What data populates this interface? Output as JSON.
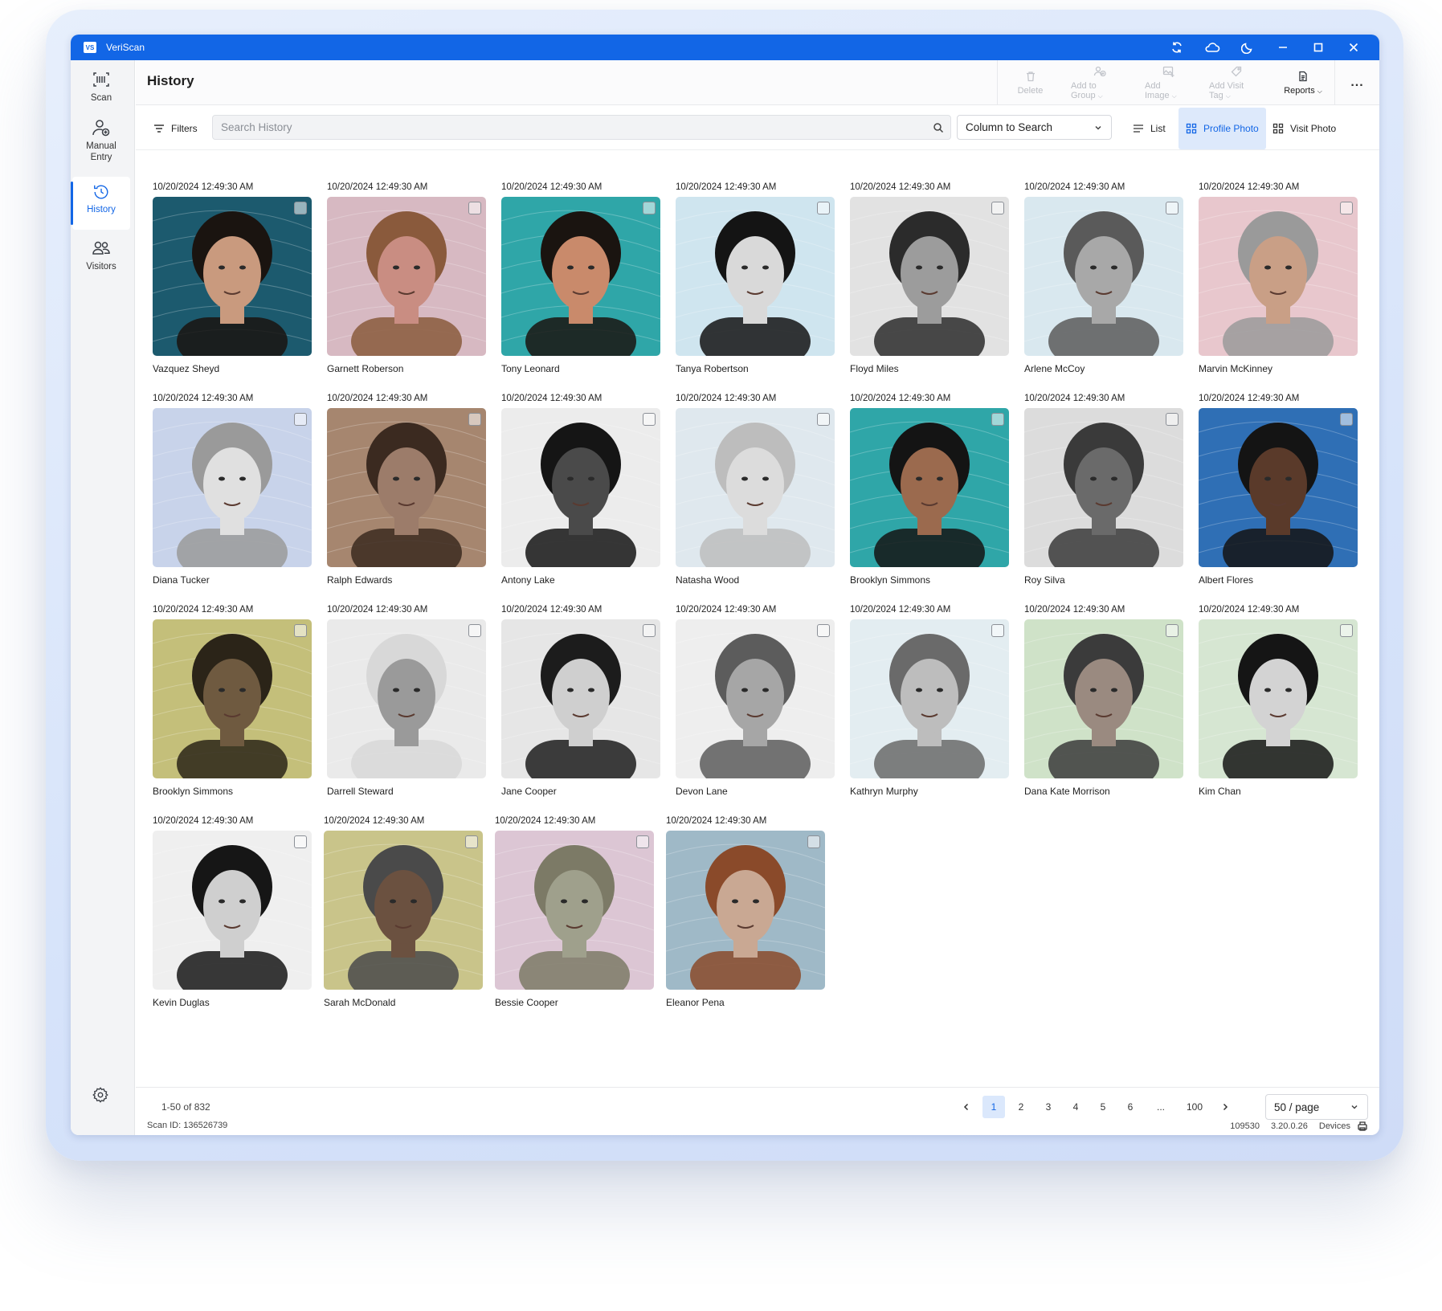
{
  "app": {
    "logo_text": "VS",
    "title": "VeriScan"
  },
  "titlebar_icons": [
    "sync-icon",
    "cloud-icon",
    "moon-icon",
    "minimize-icon",
    "maximize-icon",
    "close-icon"
  ],
  "sidebar": {
    "items": [
      {
        "label": "Scan",
        "icon": "barcode-scan-icon"
      },
      {
        "label": "Manual\nEntry",
        "icon": "add-person-icon"
      },
      {
        "label": "History",
        "icon": "history-icon",
        "active": true
      },
      {
        "label": "Visitors",
        "icon": "visitors-icon"
      }
    ],
    "settings_icon": "gear-icon"
  },
  "header": {
    "title": "History",
    "actions": [
      {
        "label": "Delete",
        "icon": "trash-icon",
        "enabled": false,
        "dropdown": false
      },
      {
        "label": "Add to Group",
        "icon": "group-icon",
        "enabled": false,
        "dropdown": true
      },
      {
        "label": "Add Image",
        "icon": "image-icon",
        "enabled": false,
        "dropdown": true
      },
      {
        "label": "Add Visit Tag",
        "icon": "tag-icon",
        "enabled": false,
        "dropdown": true
      },
      {
        "label": "Reports",
        "icon": "report-icon",
        "enabled": true,
        "dropdown": true
      }
    ],
    "more_label": "..."
  },
  "toolbar": {
    "filters_label": "Filters",
    "search_placeholder": "Search History",
    "search_value": "",
    "column_select_value": "Column to Search",
    "views": [
      {
        "label": "List",
        "icon": "list-icon",
        "active": false
      },
      {
        "label": "Profile Photo",
        "icon": "grid-icon",
        "active": true
      },
      {
        "label": "Visit Photo",
        "icon": "grid-icon",
        "active": false
      }
    ]
  },
  "records": [
    {
      "date": "10/20/2024  12:49:30 AM",
      "name": "Vazquez Sheyd",
      "bg": "#1c5a6e",
      "skin": "#c99a7e",
      "hair": "#1a1410"
    },
    {
      "date": "10/20/2024  12:49:30 AM",
      "name": "Garnett Roberson",
      "bg": "#d7b9c2",
      "skin": "#c98d82",
      "hair": "#8a5a3c"
    },
    {
      "date": "10/20/2024  12:49:30 AM",
      "name": "Tony Leonard",
      "bg": "#2fa6a8",
      "skin": "#c98a6b",
      "hair": "#1a1410"
    },
    {
      "date": "10/20/2024  12:49:30 AM",
      "name": "Tanya Robertson",
      "bg": "#cfe5ef",
      "skin": "#d9d9d9",
      "hair": "#141414"
    },
    {
      "date": "10/20/2024  12:49:30 AM",
      "name": "Floyd Miles",
      "bg": "#e2e2e2",
      "skin": "#9c9c9c",
      "hair": "#2b2b2b"
    },
    {
      "date": "10/20/2024  12:49:30 AM",
      "name": "Arlene McCoy",
      "bg": "#d9e8ef",
      "skin": "#a8a8a8",
      "hair": "#5a5a5a"
    },
    {
      "date": "10/20/2024  12:49:30 AM",
      "name": "Marvin McKinney",
      "bg": "#e8c7cd",
      "skin": "#c99f86",
      "hair": "#9a9a9a"
    },
    {
      "date": "10/20/2024  12:49:30 AM",
      "name": "Diana Tucker",
      "bg": "#c8d3ea",
      "skin": "#e0e0e0",
      "hair": "#9a9a9a"
    },
    {
      "date": "10/20/2024  12:49:30 AM",
      "name": "Ralph Edwards",
      "bg": "#a6866f",
      "skin": "#9c7c6a",
      "hair": "#3b2a20"
    },
    {
      "date": "10/20/2024  12:49:30 AM",
      "name": "Antony Lake",
      "bg": "#ececec",
      "skin": "#4a4a4a",
      "hair": "#151515"
    },
    {
      "date": "10/20/2024  12:49:30 AM",
      "name": "Natasha Wood",
      "bg": "#dfe8ee",
      "skin": "#dcdcdc",
      "hair": "#bdbdbd"
    },
    {
      "date": "10/20/2024  12:49:30 AM",
      "name": "Brooklyn Simmons",
      "bg": "#2fa6a8",
      "skin": "#9b6a4e",
      "hair": "#141414"
    },
    {
      "date": "10/20/2024  12:49:30 AM",
      "name": "Roy Silva",
      "bg": "#dcdcdc",
      "skin": "#6a6a6a",
      "hair": "#3a3a3a"
    },
    {
      "date": "10/20/2024  12:49:30 AM",
      "name": "Albert Flores",
      "bg": "#2f6fb5",
      "skin": "#5a3a2a",
      "hair": "#141414"
    },
    {
      "date": "10/20/2024  12:49:30 AM",
      "name": "Brooklyn Simmons",
      "bg": "#c4bf7a",
      "skin": "#6f5a40",
      "hair": "#2b2418"
    },
    {
      "date": "10/20/2024  12:49:30 AM",
      "name": "Darrell Steward",
      "bg": "#eaeaea",
      "skin": "#9a9a9a",
      "hair": "#d8d8d8"
    },
    {
      "date": "10/20/2024  12:49:30 AM",
      "name": "Jane Cooper",
      "bg": "#e6e6e6",
      "skin": "#cfcfcf",
      "hair": "#1c1c1c"
    },
    {
      "date": "10/20/2024  12:49:30 AM",
      "name": "Devon Lane",
      "bg": "#eeeeee",
      "skin": "#a6a6a6",
      "hair": "#5c5c5c"
    },
    {
      "date": "10/20/2024  12:49:30 AM",
      "name": "Kathryn Murphy",
      "bg": "#e3edf1",
      "skin": "#bdbdbd",
      "hair": "#6a6a6a"
    },
    {
      "date": "10/20/2024  12:49:30 AM",
      "name": "Dana Kate Morrison",
      "bg": "#cfe2c8",
      "skin": "#9a8a80",
      "hair": "#3b3b3b"
    },
    {
      "date": "10/20/2024  12:49:30 AM",
      "name": "Kim Chan",
      "bg": "#d6e6d2",
      "skin": "#d3d3d3",
      "hair": "#151515"
    },
    {
      "date": "10/20/2024  12:49:30 AM",
      "name": "Kevin Duglas",
      "bg": "#efefef",
      "skin": "#cfcfcf",
      "hair": "#161616"
    },
    {
      "date": "10/20/2024  12:49:30 AM",
      "name": "Sarah McDonald",
      "bg": "#c9c48a",
      "skin": "#6b5140",
      "hair": "#4a4a4a"
    },
    {
      "date": "10/20/2024  12:49:30 AM",
      "name": "Bessie Cooper",
      "bg": "#dcc6d4",
      "skin": "#9fa08c",
      "hair": "#7c7a66"
    },
    {
      "date": "10/20/2024  12:49:30 AM",
      "name": "Eleanor Pena",
      "bg": "#9fb9c7",
      "skin": "#c9a893",
      "hair": "#8a4a2a"
    }
  ],
  "pagination": {
    "range": "1-50  of 832",
    "pages": [
      "1",
      "2",
      "3",
      "4",
      "5",
      "6",
      "...",
      "100"
    ],
    "current": "1",
    "per_page": "50 / page"
  },
  "status": {
    "scan_id": "Scan ID:  136526739",
    "code": "109530",
    "version": "3.20.0.26",
    "devices_label": "Devices"
  }
}
